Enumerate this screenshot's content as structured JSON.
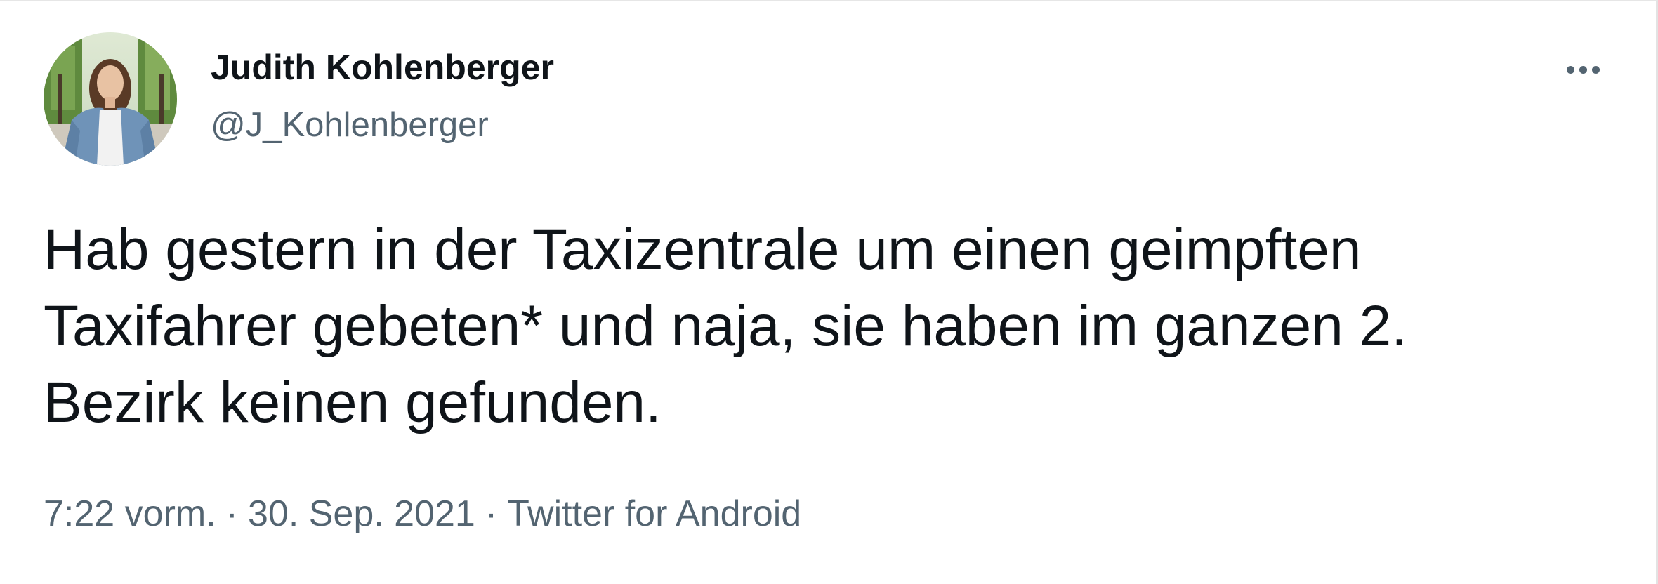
{
  "author": {
    "display_name": "Judith Kohlenberger",
    "handle": "@J_Kohlenberger",
    "avatar_icon": "profile-photo"
  },
  "more_icon": "more-horizontal-icon",
  "tweet": {
    "text_lines": [
      "Hab gestern in der Taxizentrale um einen geimpften",
      "Taxifahrer gebeten* und naja, sie haben im ganzen 2.",
      "Bezirk keinen gefunden."
    ]
  },
  "meta": {
    "time": "7:22 vorm.",
    "separator": "·",
    "date": "30. Sep. 2021",
    "source": "Twitter for Android"
  },
  "colors": {
    "text": "#0f1419",
    "secondary": "#536471",
    "background": "#ffffff"
  }
}
